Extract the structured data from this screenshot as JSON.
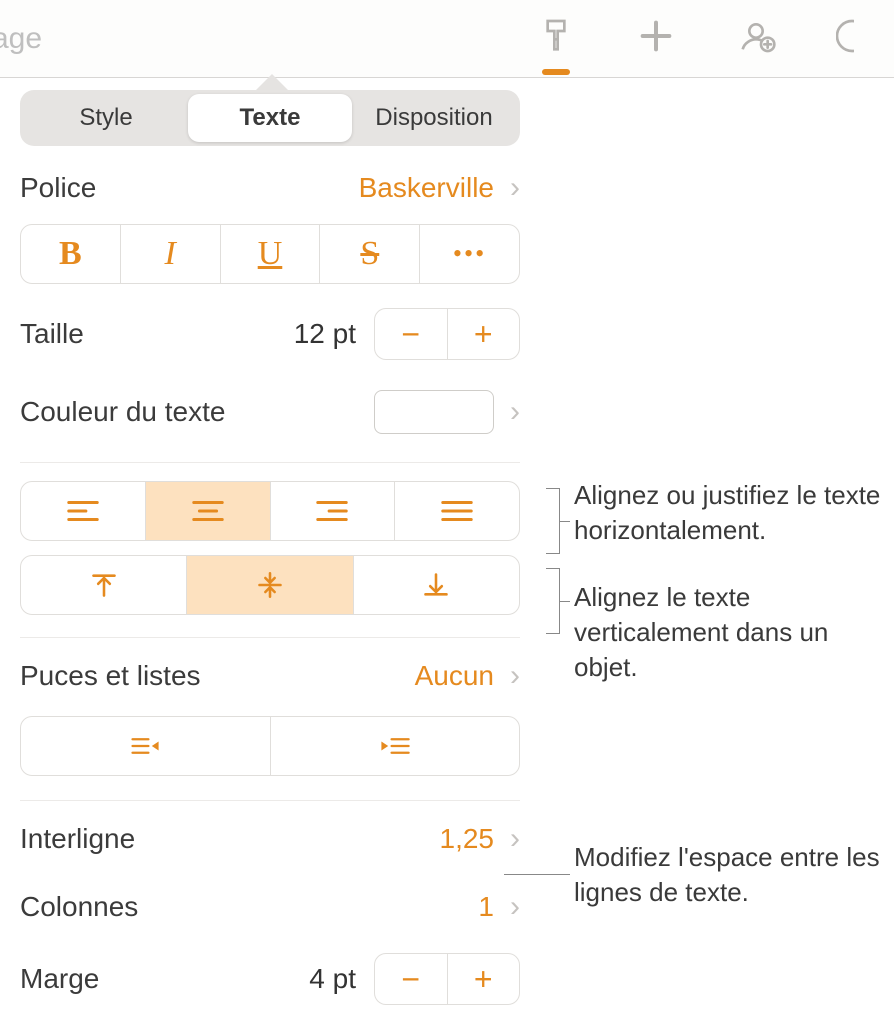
{
  "toolbar": {
    "left_label": "age"
  },
  "tabs": {
    "style": "Style",
    "texte": "Texte",
    "disposition": "Disposition"
  },
  "font": {
    "label": "Police",
    "value": "Baskerville"
  },
  "format_buttons": {
    "bold": "B",
    "italic": "I",
    "underline": "U",
    "strike": "S",
    "more": "•••"
  },
  "size": {
    "label": "Taille",
    "value": "12 pt"
  },
  "text_color": {
    "label": "Couleur du texte"
  },
  "bullets": {
    "label": "Puces et listes",
    "value": "Aucun"
  },
  "line_spacing": {
    "label": "Interligne",
    "value": "1,25"
  },
  "columns": {
    "label": "Colonnes",
    "value": "1"
  },
  "margin": {
    "label": "Marge",
    "value": "4 pt"
  },
  "callouts": {
    "h_align": "Alignez ou justifiez le texte horizontalement.",
    "v_align": "Alignez le texte verticalement dans un objet.",
    "line_space": "Modifiez l'espace entre les lignes de texte."
  }
}
